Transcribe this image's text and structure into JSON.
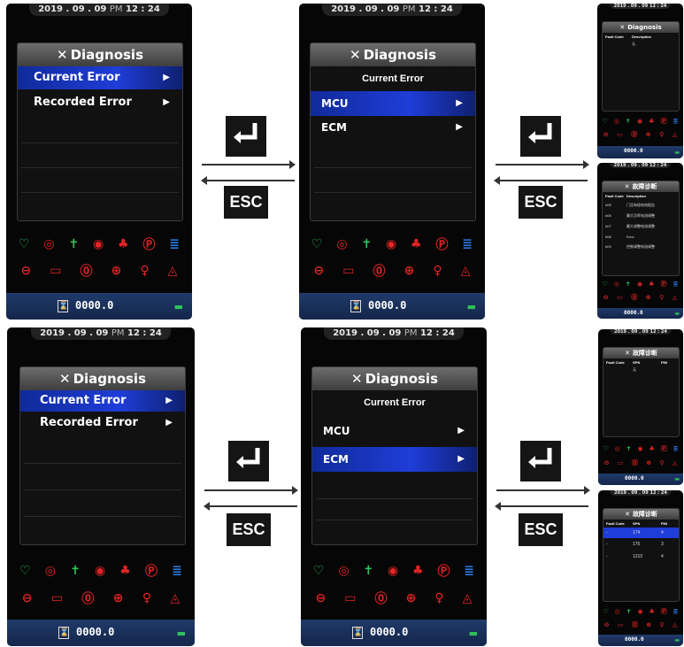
{
  "status_bar": {
    "date": "2019 . 09 . 09",
    "ampm": "PM",
    "time": "12 : 24"
  },
  "diagnosis_title": "Diagnosis",
  "menu1": {
    "item1": "Current Error",
    "item2": "Recorded Error"
  },
  "menu2": {
    "subtitle": "Current Error",
    "item1": "MCU",
    "item2": "ECM"
  },
  "keys": {
    "enter_symbol": "↵",
    "esc": "ESC"
  },
  "odometer": "0000.0",
  "right_screens": {
    "s1": {
      "title": "Diagnosis",
      "col1": "Fault Code",
      "col2": "Description",
      "empty": "无"
    },
    "s2": {
      "title": "故障诊断",
      "col1": "Fault Code",
      "col2": "Description",
      "rows": [
        {
          "code": "#05",
          "desc": "门没有插电电报告"
        },
        {
          "code": "#06",
          "desc": "最大功率电流调整"
        },
        {
          "code": "#07",
          "desc": "最大调整电流调整"
        },
        {
          "code": "#08",
          "desc": "Error"
        },
        {
          "code": "#09",
          "desc": "控制调整电流调整"
        }
      ]
    },
    "s3": {
      "title": "故障诊断",
      "col1": "Fault Code",
      "col2": "SPN",
      "col3": "FMI",
      "empty": "无"
    },
    "s4": {
      "title": "故障诊断",
      "col1": "Fault Code",
      "col2": "SPN",
      "col3": "FMI",
      "rows": [
        {
          "code": "-",
          "spn": "174",
          "fmi": "4"
        },
        {
          "code": "-",
          "spn": "175",
          "fmi": "3"
        },
        {
          "code": "-",
          "spn": "1210",
          "fmi": "4"
        }
      ]
    }
  },
  "indicator_icons_row1": [
    "brake-icon",
    "seatbelt-icon",
    "engine-temp-icon",
    "oil-icon",
    "battery-icon",
    "parking-icon",
    "headlight-icon"
  ],
  "indicator_icons_row2": [
    "oil-filter-icon",
    "fuel-icon",
    "coolant-icon",
    "service-icon",
    "key-icon",
    "tire-icon"
  ],
  "colors": {
    "highlight": "#1f3dd8",
    "header_gray": "#5a5a5a",
    "footer": "#1a3260",
    "green": "#2fc25a",
    "red": "#e32424"
  }
}
